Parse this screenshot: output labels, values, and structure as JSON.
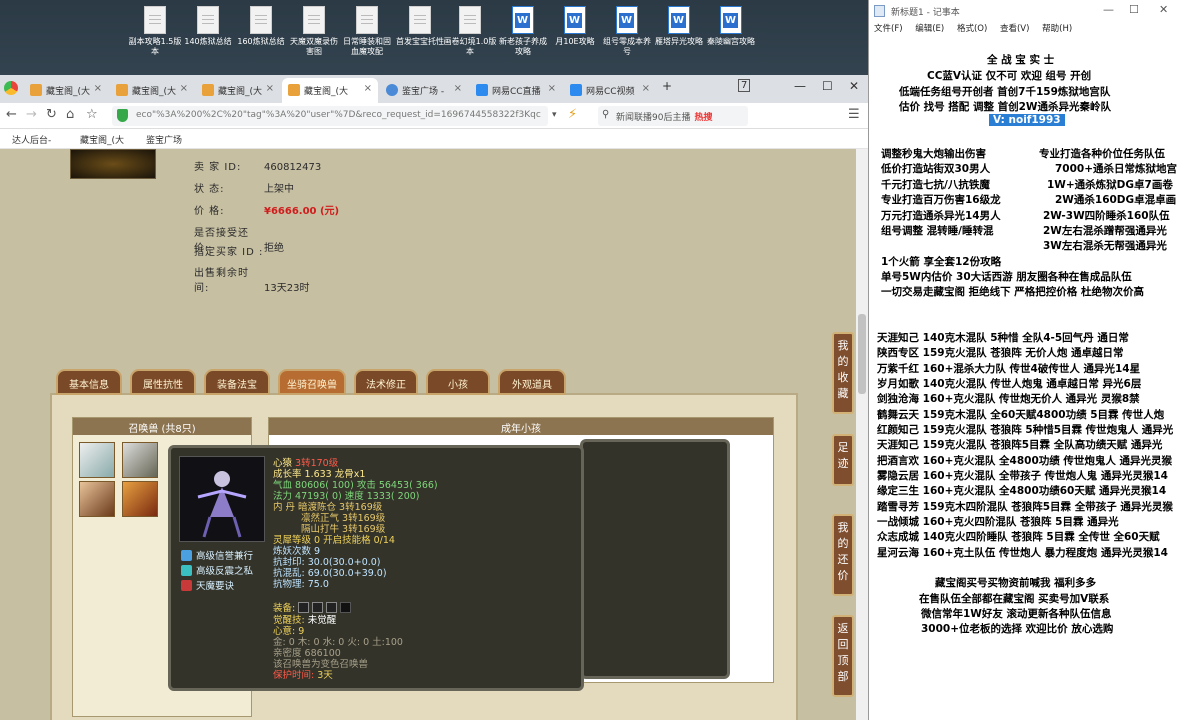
{
  "desktop": {
    "icons": [
      {
        "label": "副本攻略1.5版本",
        "type": "doc"
      },
      {
        "label": "140炼狱总结",
        "type": "doc"
      },
      {
        "label": "160炼狱总结",
        "type": "doc"
      },
      {
        "label": "天魔双魔录伤害图",
        "type": "doc"
      },
      {
        "label": "日常睡装和固血魔攻配",
        "type": "doc"
      },
      {
        "label": "首发宝宝托性",
        "type": "doc"
      },
      {
        "label": "画卷幻境1.0版本",
        "type": "doc"
      },
      {
        "label": "新老孩子养成攻略",
        "type": "word"
      },
      {
        "label": "月10E攻略",
        "type": "word"
      },
      {
        "label": "组号零成本养号",
        "type": "word"
      },
      {
        "label": "雁塔异光攻略",
        "type": "word"
      },
      {
        "label": "秦陵幽宫攻略",
        "type": "word"
      }
    ]
  },
  "browser": {
    "tabs": [
      {
        "label": "藏宝阁_(大",
        "active": false
      },
      {
        "label": "藏宝阁_(大",
        "active": false
      },
      {
        "label": "藏宝阁_(大",
        "active": false
      },
      {
        "label": "藏宝阁_(大",
        "active": true
      },
      {
        "label": "鉴宝广场 -",
        "active": false
      },
      {
        "label": "网易CC直播",
        "active": false
      },
      {
        "label": "网易CC视频",
        "active": false
      }
    ],
    "new_tab": "+",
    "url": "eco\"%3A%200%2C%20\"tag\"%3A%20\"user\"%7D&reco_request_id=1696744558322f3Kqc",
    "search_text": "新闻联播90后主播",
    "hot_label": "热搜",
    "bookmarks": [
      "达人后台-",
      "藏宝阁_(大",
      "鉴宝广场"
    ]
  },
  "listing": {
    "seller_label": "卖 家 ID:",
    "seller_id": "460812473",
    "status_label": "状 态:",
    "status": "上架中",
    "price_label": "价 格:",
    "price": "¥6666.00 (元)",
    "bargain_label": "是否接受还价:",
    "bargain": "拒绝",
    "buyer_label": "指定买家 ID :",
    "buyer": "",
    "time_label": "出售剩余时间:",
    "time_left": "13天23时"
  },
  "game_tabs": [
    "基本信息",
    "属性抗性",
    "装备法宝",
    "坐骑召唤兽",
    "法术修正",
    "小孩",
    "外观道具"
  ],
  "active_game_tab": 3,
  "summon_box": {
    "title": "召唤兽 (共8只)"
  },
  "child_box": {
    "title": "成年小孩"
  },
  "pet_popup": {
    "name_label": "心猿",
    "name_value": "3转170级",
    "growth": "成长率 1.633 龙骨x1",
    "hp": "气血 80606( 100) 攻击 56453( 366)",
    "mp": "法力 47193( 0) 速度 1333( 200)",
    "dan1": "内 丹 暗渡陈仓 3转169级",
    "dan2": "凛然正气 3转169级",
    "dan3": "隔山打牛 3转169级",
    "lingxi": "灵犀等级 0 开启技能格 0/14",
    "yao_count": "炼妖次数 9",
    "resist1": "抗封印: 30.0(30.0+0.0)",
    "resist2": "抗混乱: 69.0(30.0+39.0)",
    "resist3": "抗物理: 75.0",
    "equip_label": "装备:",
    "jx_label": "觉醒技:",
    "jx_value": "未觉醒",
    "xinyi_label": "心意:",
    "xinyi_value": "9",
    "elements": "金: 0 木: 0 水: 0 火: 0 土:100",
    "intimacy": "亲密度 686100",
    "transform": "该召唤兽为变色召唤兽",
    "protect_label": "保护时间:",
    "protect_value": "3天",
    "skills": [
      "高级信誉兼行",
      "高级反震之私",
      "天魔要诀"
    ]
  },
  "side_buttons": [
    "我的收藏",
    "足迹",
    "我的还价",
    "返回顶部"
  ],
  "notepad": {
    "title": "新标题1 - 记事本",
    "menu": [
      "文件(F)",
      "编辑(E)",
      "格式(O)",
      "查看(V)",
      "帮助(H)"
    ],
    "header_lines": [
      "全 战 宝 实 士",
      "CC蓝V认证 仅不可 欢迎 组号 开创",
      "低端任务组号开创者          首创7千159炼狱地宫队",
      "估价 找号 搭配 调整          首创2W通杀异光秦岭队"
    ],
    "vline": "V:  noif1993",
    "block1_left": [
      "调整秒鬼大炮输出伤害",
      "低价打造站街双30男人",
      "千元打造七抗/八抗铁魔",
      "专业打造百万伤害16级龙",
      "万元打造通杀异光14男人",
      "组号调整 混转睡/睡转混"
    ],
    "block1_right": [
      "专业打造各种价位任务队伍",
      "7000+通杀日常炼狱地宫",
      "1W+通杀炼狱DG卓7画卷",
      "2W通杀160DG卓混卓画",
      "2W-3W四阶睡杀160队伍",
      "2W左右混杀蹭帮强通异光",
      "3W左右混杀无帮强通异光"
    ],
    "line_a": "1个火箭 享全套12份攻略",
    "line_b": "单号5W内估价 30大话西游          朋友圈各种在售成品队伍",
    "line_c": "一切交易走藏宝阁 拒绝线下      严格把控价格 杜绝物次价高",
    "list": [
      "天涯知己 140克木混队 5种惜 全队4-5回气丹 通日常",
      "陕西专区 159克火混队 苍狼阵 无价人炮 通卓越日常",
      "万紫千红 160+混杀大力队 传世4破传世人 通异光14星",
      "岁月如歌 140克火混队 传世人炮鬼 通卓越日常 异光6层",
      "剑独沧海 160+克火混队 传世炮无价人 通异光 灵猴8禁",
      "鹤舞云天 159克木混队 全60天赋4800功绩 5目霖 传世人炮",
      "红颜知己 159克火混队 苍狼阵 5种惜5目霖 传世炮鬼人 通异光",
      "天涯知己 159克火混队 苍狼阵5目霖 全队高功绩天赋 通异光",
      "把酒言欢 160+克火混队 全4800功绩 传世炮鬼人 通异光灵猴",
      "雾隐云居 160+克火混队 全带孩子 传世炮人鬼 通异光灵猴14",
      "缘定三生 160+克火混队 全4800功绩60天赋 通异光灵猴14",
      "踏雪寻芳 159克木四阶混队 苍狼阵5目霖 全带孩子 通异光灵猴",
      "一战倾城 160+克火四阶混队 苍狼阵 5目霖 通异光",
      "众志成城 140克火四阶睡队 苍狼阵 5目霖 全传世 全60天赋",
      "星河云海 160+克土队伍 传世炮人 暴力程度炮 通异光灵猴14"
    ],
    "footer": [
      "藏宝阁买号买物资前喊我 福利多多",
      "在售队伍全部都在藏宝阁 买卖号加V联系",
      "微信常年1W好友 滚动更新各种队伍信息",
      "3000+位老板的选择 欢迎比价 放心选购"
    ]
  }
}
